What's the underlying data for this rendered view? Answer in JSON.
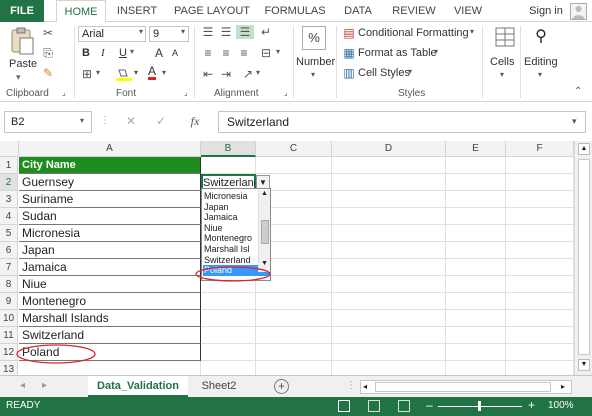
{
  "ribbon": {
    "tabs": [
      "FILE",
      "HOME",
      "INSERT",
      "PAGE LAYOUT",
      "FORMULAS",
      "DATA",
      "REVIEW",
      "VIEW"
    ],
    "signin": "Sign in",
    "clipboard": {
      "paste": "Paste",
      "label": "Clipboard"
    },
    "font": {
      "name": "Arial",
      "size": "9",
      "bold": "B",
      "italic": "I",
      "underline": "U",
      "grow": "A",
      "shrink": "A",
      "fontcolor": "A",
      "label": "Font"
    },
    "alignment": {
      "label": "Alignment"
    },
    "number": {
      "label": "Number",
      "symbol": "%"
    },
    "styles": {
      "conditional": "Conditional Formatting",
      "table": "Format as Table",
      "cell": "Cell Styles",
      "label": "Styles"
    },
    "cells": {
      "label": "Cells"
    },
    "editing": {
      "label": "Editing"
    }
  },
  "formula_bar": {
    "namebox": "B2",
    "fx": "fx",
    "value": "Switzerland"
  },
  "columns": [
    "A",
    "B",
    "C",
    "D",
    "E",
    "F"
  ],
  "rows": [
    "1",
    "2",
    "3",
    "4",
    "5",
    "6",
    "7",
    "8",
    "9",
    "10",
    "11",
    "12",
    "13"
  ],
  "cells_a": [
    "City Name",
    "Guernsey",
    "Suriname",
    "Sudan",
    "Micronesia",
    "Japan",
    "Jamaica",
    "Niue",
    "Montenegro",
    "Marshall Islands",
    "Switzerland",
    "Poland",
    ""
  ],
  "b2_value": "Switzerland",
  "dropdown": [
    "Micronesia",
    "Japan",
    "Jamaica",
    "Niue",
    "Montenegro",
    "Marshall Isl",
    "Switzerland",
    "Poland"
  ],
  "sheets": {
    "active": "Data_Validation",
    "other": "Sheet2"
  },
  "status": {
    "ready": "READY",
    "zoom": "100%"
  },
  "colors": {
    "accent": "#217346",
    "header_fill": "#1e8c1e",
    "highlight": "#3399ff",
    "annotation": "#d9232e"
  }
}
